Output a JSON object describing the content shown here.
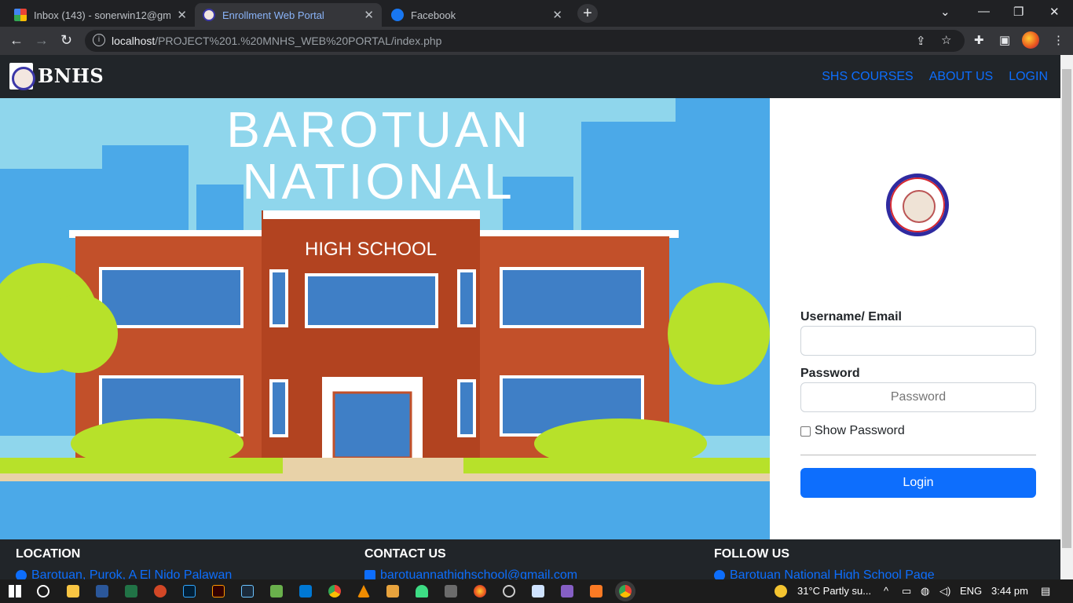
{
  "browser": {
    "tabs": [
      {
        "title": "Inbox (143) - sonerwin12@gmail"
      },
      {
        "title": "Enrollment Web Portal"
      },
      {
        "title": "Facebook"
      }
    ],
    "url_host": "localhost",
    "url_path": "/PROJECT%201.%20MNHS_WEB%20PORTAL/index.php"
  },
  "navbar": {
    "brand": "BNHS",
    "links": [
      "SHS COURSES",
      "ABOUT US",
      "LOGIN"
    ]
  },
  "hero": {
    "line1": "BAROTUAN",
    "line2": "NATIONAL",
    "sign": "HIGH SCHOOL"
  },
  "login": {
    "username_label": "Username/ Email",
    "username_value": "",
    "password_label": "Password",
    "password_placeholder": "Password",
    "show_password": "Show Password",
    "login_button": "Login"
  },
  "footer": {
    "location_heading": "LOCATION",
    "location_text": "Barotuan, Purok, A El Nido Palawan",
    "contact_heading": "CONTACT US",
    "contact_text": "barotuannathighschool@gmail.com",
    "follow_heading": "FOLLOW US",
    "follow_text": "Barotuan National High School Page"
  },
  "taskbar": {
    "weather": "31°C  Partly su...",
    "lang": "ENG",
    "time": "3:44 pm"
  },
  "colors": {
    "accent": "#0d6efd",
    "navbar": "#212529"
  }
}
